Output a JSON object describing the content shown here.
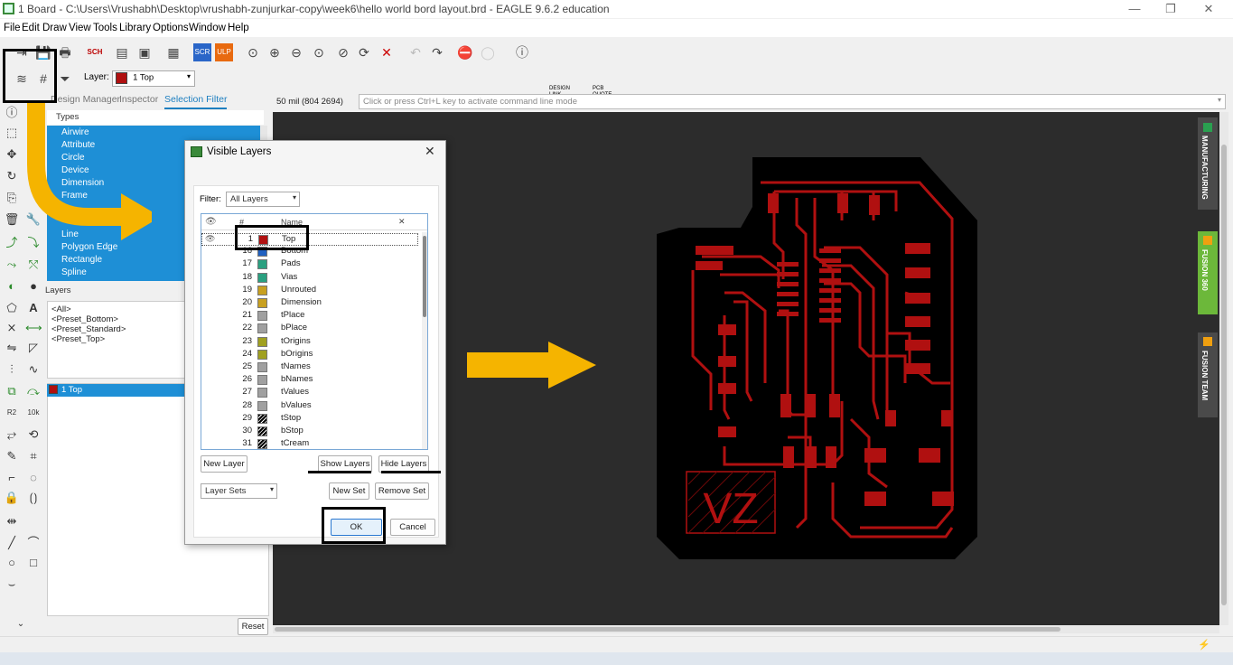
{
  "window": {
    "title": "1 Board - C:\\Users\\Vrushabh\\Desktop\\vrushabh-zunjurkar-copy\\week6\\hello world bord layout.brd - EAGLE 9.6.2 education"
  },
  "menu": [
    "File",
    "Edit",
    "Draw",
    "View",
    "Tools",
    "Library",
    "Options",
    "Window",
    "Help"
  ],
  "toolbar": {
    "layer_label": "Layer:",
    "layer_value": "1 Top",
    "design_link": "DESIGN LINK",
    "pcb_quote": "PCB QUOTE"
  },
  "panel": {
    "tabs": [
      "Design Manager",
      "Inspector",
      "Selection Filter"
    ],
    "types_header": "Types",
    "types": [
      "Airwire",
      "Attribute",
      "Circle",
      "Device",
      "Dimension",
      "Frame",
      "Line",
      "Polygon Edge",
      "Rectangle",
      "Spline"
    ],
    "layers_header": "Layers",
    "layer_presets": [
      "<All>",
      "<Preset_Bottom>",
      "<Preset_Standard>",
      "<Preset_Top>"
    ],
    "selected_layer": "1 Top",
    "reset": "Reset"
  },
  "command": {
    "coords": "50 mil (804 2694)",
    "placeholder": "Click or press Ctrl+L key to activate command line mode"
  },
  "dialog": {
    "title": "Visible Layers",
    "filter_label": "Filter:",
    "filter_value": "All Layers",
    "col_num": "#",
    "col_name": "Name",
    "layers": [
      {
        "num": "1",
        "name": "Top",
        "color": "#b01010"
      },
      {
        "num": "16",
        "name": "Bottom",
        "color": "#2060c0"
      },
      {
        "num": "17",
        "name": "Pads",
        "color": "#2aa080"
      },
      {
        "num": "18",
        "name": "Vias",
        "color": "#2aa080"
      },
      {
        "num": "19",
        "name": "Unrouted",
        "color": "#c8a020"
      },
      {
        "num": "20",
        "name": "Dimension",
        "color": "#c8a020"
      },
      {
        "num": "21",
        "name": "tPlace",
        "color": "#a0a0a0"
      },
      {
        "num": "22",
        "name": "bPlace",
        "color": "#a0a0a0"
      },
      {
        "num": "23",
        "name": "tOrigins",
        "color": "#a0a020"
      },
      {
        "num": "24",
        "name": "bOrigins",
        "color": "#a0a020"
      },
      {
        "num": "25",
        "name": "tNames",
        "color": "#a0a0a0"
      },
      {
        "num": "26",
        "name": "bNames",
        "color": "#a0a0a0"
      },
      {
        "num": "27",
        "name": "tValues",
        "color": "#a0a0a0"
      },
      {
        "num": "28",
        "name": "bValues",
        "color": "#a0a0a0"
      },
      {
        "num": "29",
        "name": "tStop",
        "color": "#000000"
      },
      {
        "num": "30",
        "name": "bStop",
        "color": "#000000"
      },
      {
        "num": "31",
        "name": "tCream",
        "color": "#000000"
      }
    ],
    "new_layer": "New Layer",
    "show_layers": "Show Layers",
    "hide_layers": "Hide Layers",
    "layer_sets": "Layer Sets",
    "new_set": "New Set",
    "remove_set": "Remove Set",
    "ok": "OK",
    "cancel": "Cancel"
  },
  "side_tabs": [
    "MANUFACTURING",
    "FUSION 360",
    "FUSION TEAM"
  ],
  "board_text": "VZ",
  "colors": {
    "trace": "#b01010",
    "selection": "#1e8fd6",
    "arrow": "#f5b400",
    "canvas": "#2c2c2c"
  }
}
